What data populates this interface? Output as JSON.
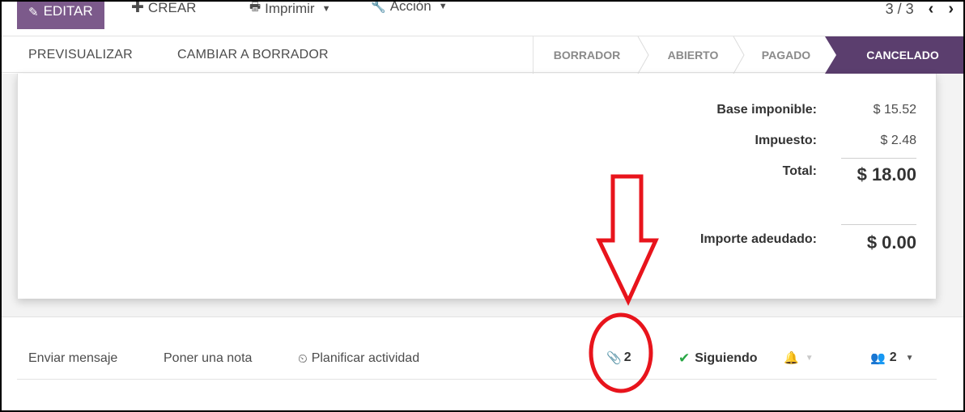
{
  "toolbar": {
    "edit_label": "EDITAR",
    "create_label": "CREAR",
    "print_label": "Imprimir",
    "action_label": "Acción",
    "pager_text": "3 / 3",
    "prev_icon": "chevron-left-icon",
    "next_icon": "chevron-right-icon"
  },
  "statusbar": {
    "preview_label": "PREVISUALIZAR",
    "draft_label": "CAMBIAR A BORRADOR",
    "stages": [
      "BORRADOR",
      "ABIERTO",
      "PAGADO",
      "CANCELADO"
    ],
    "active_stage": "CANCELADO"
  },
  "totals": {
    "base_label": "Base imponible:",
    "base_value": "$ 15.52",
    "tax_label": "Impuesto:",
    "tax_value": "$ 2.48",
    "total_label": "Total:",
    "total_value": "$ 18.00",
    "due_label": "Importe adeudado:",
    "due_value": "$ 0.00"
  },
  "chatter": {
    "send_message": "Enviar mensaje",
    "log_note": "Poner una nota",
    "schedule_activity": "Planificar actividad",
    "attachments_count": "2",
    "following_label": "Siguiendo",
    "followers_count": "2"
  },
  "colors": {
    "brand": "#7c5a8b",
    "active_stage": "#5b3e6e",
    "annotation": "#e8141c",
    "check": "#28a745"
  }
}
